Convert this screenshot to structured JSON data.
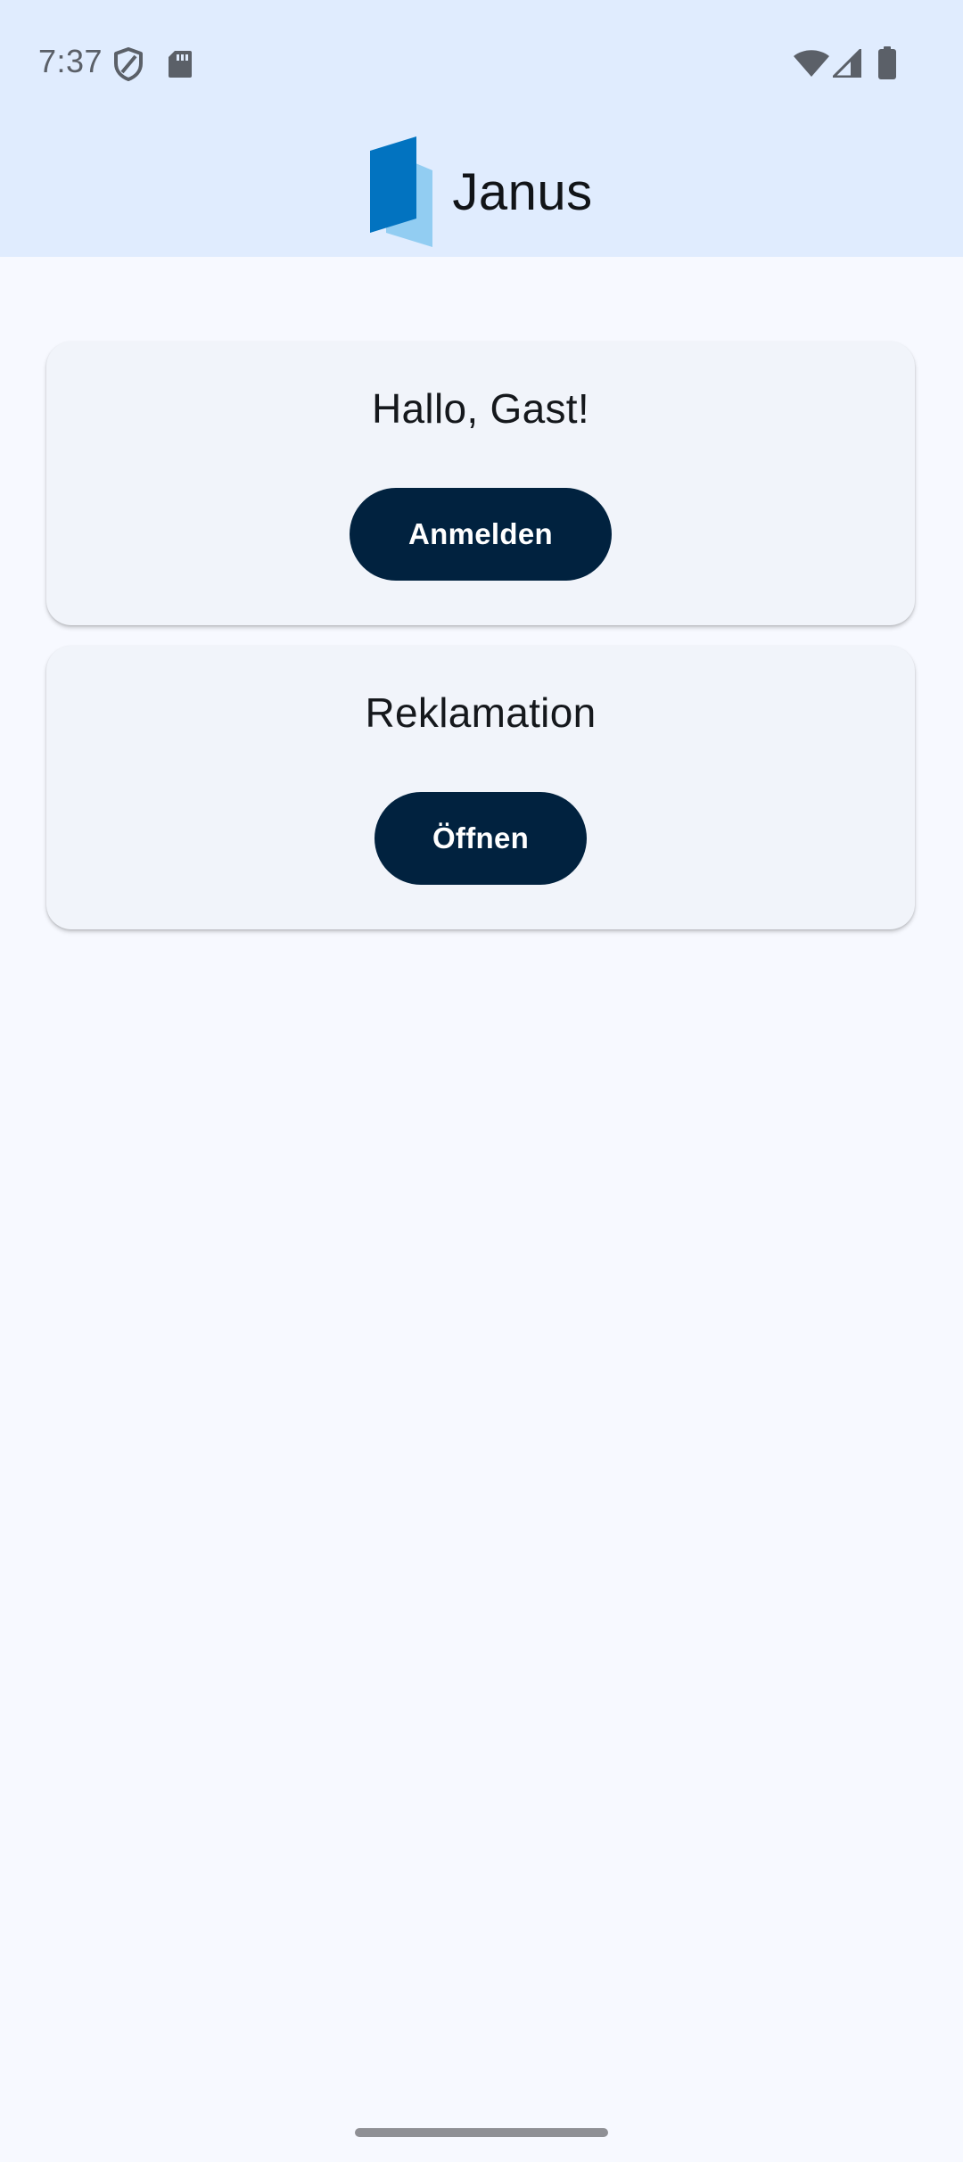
{
  "status_bar": {
    "time": "7:37",
    "icons": [
      "shield-icon",
      "sd-card-icon",
      "wifi-icon",
      "cellular-signal-icon",
      "battery-icon"
    ]
  },
  "header": {
    "title": "Janus",
    "logo": "janus-logo-icon"
  },
  "cards": [
    {
      "title": "Hallo, Gast!",
      "button_label": "Anmelden"
    },
    {
      "title": "Reklamation",
      "button_label": "Öffnen"
    }
  ],
  "colors": {
    "header_bg": "#e0ecfe",
    "page_bg": "#f7f9ff",
    "card_bg": "#f1f4fa",
    "button_bg": "#01223f",
    "logo_dark": "#0273c0",
    "logo_light": "#92cdf2"
  }
}
